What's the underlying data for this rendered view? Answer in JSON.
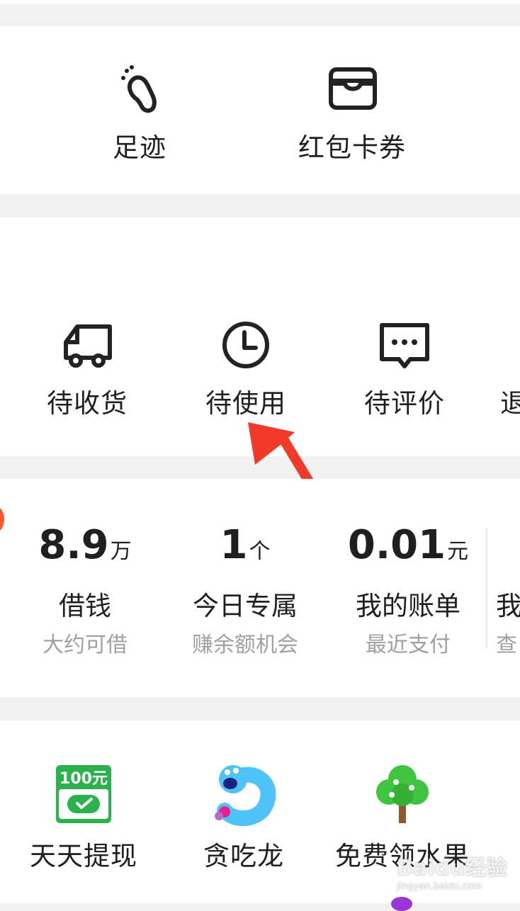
{
  "shortcuts": [
    {
      "label": "足迹",
      "icon": "footprint-icon"
    },
    {
      "label": "红包卡券",
      "icon": "wallet-card-icon"
    }
  ],
  "orders": [
    {
      "label": "待收货",
      "icon": "truck-icon"
    },
    {
      "label": "待使用",
      "icon": "clock-icon"
    },
    {
      "label": "待评价",
      "icon": "comment-icon"
    },
    {
      "label": "退",
      "icon": ""
    }
  ],
  "finance": [
    {
      "value": "8.9",
      "unit": "万",
      "name": "借钱",
      "sub": "大约可借"
    },
    {
      "value": "1",
      "unit": "个",
      "name": "今日专属",
      "sub": "赚余额机会"
    },
    {
      "value": "0.01",
      "unit": "元",
      "name": "我的账单",
      "sub": "最近支付"
    },
    {
      "value": "",
      "unit": "",
      "name": "我",
      "sub": "查"
    }
  ],
  "games": [
    {
      "label": "天天提现",
      "icon": "cash-100-icon",
      "badge": "100元"
    },
    {
      "label": "贪吃龙",
      "icon": "snake-icon"
    },
    {
      "label": "免费领水果",
      "icon": "fruit-tree-icon"
    }
  ],
  "watermark": {
    "brand": "Baidu经验",
    "url": "jingyan.baidu.com"
  },
  "colors": {
    "arrow": "#f23a2a",
    "badge_green": "#2bb24c",
    "tree_green": "#3ec43e",
    "snake_blue": "#4fc3f7"
  }
}
